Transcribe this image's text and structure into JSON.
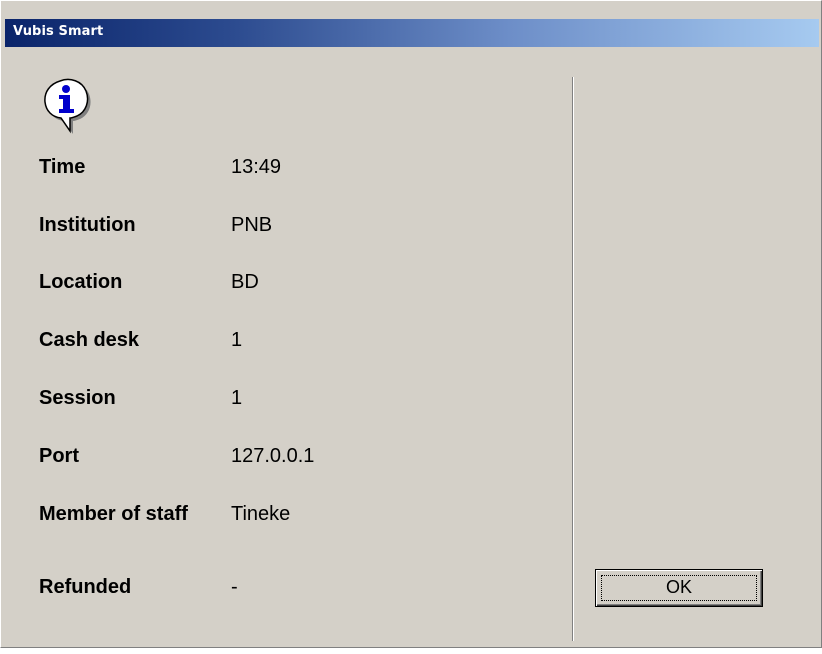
{
  "window": {
    "title": "Vubis Smart"
  },
  "icon": "info-icon",
  "fields": [
    {
      "label": "Time",
      "value": "13:49"
    },
    {
      "label": "Institution",
      "value": "PNB"
    },
    {
      "label": "Location",
      "value": "BD"
    },
    {
      "label": "Cash desk",
      "value": "1"
    },
    {
      "label": "Session",
      "value": "1"
    },
    {
      "label": "Port",
      "value": "127.0.0.1"
    },
    {
      "label": "Member of staff",
      "value": "Tineke"
    },
    {
      "label": "Refunded",
      "value": "-"
    }
  ],
  "buttons": {
    "ok_label": "OK"
  },
  "colors": {
    "dialog_background": "#d4d0c8",
    "titlebar_start": "#0a246a",
    "titlebar_end": "#a6caf0",
    "icon_blue": "#0000cc"
  }
}
